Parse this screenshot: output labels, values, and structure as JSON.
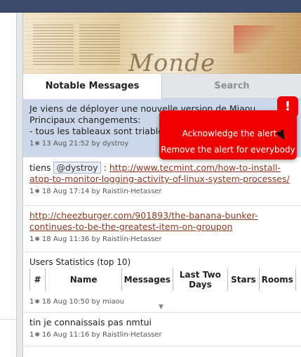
{
  "banner": {
    "title": "Monde"
  },
  "tabs": [
    {
      "label": "Notable Messages",
      "active": true
    },
    {
      "label": "Search",
      "active": false
    }
  ],
  "messages": [
    {
      "lines": [
        "Je viens de déployer une nouvelle version de Miaou.",
        "Principaux changements:",
        "- tous les tableaux sont triables"
      ],
      "count": "1",
      "date": "13 Aug 21:52",
      "by": "by",
      "author": "dystroy"
    },
    {
      "prefix": "tiens",
      "mention": "@dystroy",
      "separator": ":",
      "link_part1": "http://www.tecmint.com/how-to-install-",
      "link_part2": "atop-to-monitor-logging-activity-of-linux-system-processes/",
      "count": "1",
      "date": "18 Aug 17:14",
      "by": "by",
      "author": "Raistlin-Hetasser"
    },
    {
      "link_part1": "http://cheezburger.com/901893/the-banana-bunker-",
      "link_part2": "continues-to-be-the-greatest-item-on-groupon",
      "count": "1",
      "date": "18 Aug 11:36",
      "by": "by",
      "author": "Raistlin-Hetasser"
    },
    {
      "title": "Users Statistics (top 10)",
      "columns": [
        "#",
        "Name",
        "Messages",
        "Last Two Days",
        "Stars",
        "Rooms"
      ],
      "count": "1",
      "date": "18 Aug 10:50",
      "by": "by",
      "author": "miaou"
    },
    {
      "lines": [
        "tin je connaissais pas nmtui"
      ],
      "count": "1",
      "date": "16 Aug 11:16",
      "by": "by",
      "author": "Raistlin-Hetasser"
    }
  ],
  "alert": {
    "badge": "!",
    "acknowledge_label": "Acknowledge the alert",
    "remove_label": "Remove the alert for everybody",
    "color": "#ee0000"
  }
}
